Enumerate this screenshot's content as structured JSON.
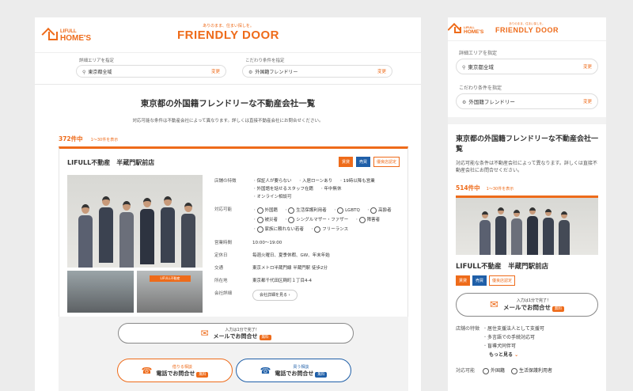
{
  "brand": {
    "logo_top": "LIFULL",
    "logo_bottom": "HOME'S",
    "tagline": "ありのまま、住まい探しを。",
    "name": "FRIENDLY DOOR"
  },
  "search": {
    "area_label": "詳細エリアを指定",
    "area_value": "東京都全域",
    "cond_label": "こだわり条件を指定",
    "cond_value": "外国籍フレンドリー",
    "change": "変更"
  },
  "page": {
    "title": "東京都の外国籍フレンドリーな不動産会社一覧",
    "note": "対応可能な条件は不動産会社によって異なります。詳しくは直接不動産会社にお問合せください。",
    "count": "372件中",
    "range": "1〜30件を表示",
    "mobile_count": "514件中"
  },
  "shop": {
    "name": "LIFULL不動産　半蔵門駅前店",
    "badges": [
      "賃貸",
      "売買",
      "優良店認定"
    ],
    "feature_label": "店舗の特徴",
    "features": [
      "保証人が要らない",
      "入居ローンあり",
      "19時以降も営業",
      "外国語を話せるスタッフ在籍",
      "年中無休",
      "オンライン相談可"
    ],
    "support_label": "対応可能",
    "supports": [
      "外国籍",
      "生活保護利用者",
      "LGBTQ",
      "高齢者",
      "被災者",
      "シングルマザー・ファザー",
      "障害者",
      "家族に頼れない若者",
      "フリーランス"
    ],
    "hours_label": "営業時間",
    "hours": "10:00〜19:00",
    "holiday_label": "定休日",
    "holiday": "毎週火曜日、夏季休暇、GW、年末年始",
    "access_label": "交通",
    "access": "東京メトロ半蔵門線 半蔵門駅 徒歩2分",
    "address_label": "所在地",
    "address": "東京都千代田区麹町１丁目4-4",
    "detail_label": "会社詳細",
    "detail_btn": "会社詳細を見る"
  },
  "cta": {
    "mail_small": "入力は1分で完了！",
    "mail": "メールでお問合せ",
    "free": "無料",
    "rent_small": "借りる相談",
    "buy_small": "買う相談",
    "tel": "電話でお問合せ"
  },
  "mobile": {
    "more": "もっと見る",
    "support_items": [
      "外国籍",
      "生活保護利用者"
    ],
    "mfeatures": [
      "居住支援法人として支援可",
      "多言語での手続対応可",
      "盲導犬同伴可"
    ]
  }
}
